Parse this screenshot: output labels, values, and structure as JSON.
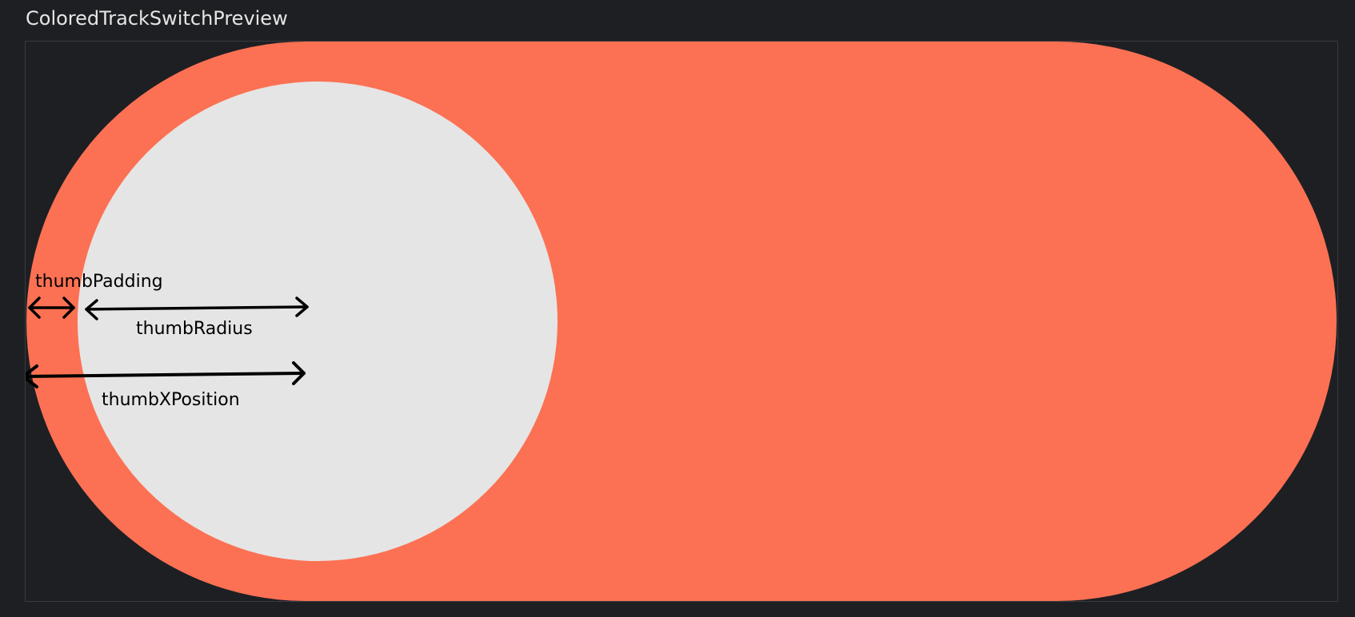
{
  "preview": {
    "title": "ColoredTrackSwitchPreview"
  },
  "switch": {
    "track_color": "#fc7153",
    "thumb_color": "#e5e5e5",
    "state": "off"
  },
  "annotations": {
    "thumb_padding": "thumbPadding",
    "thumb_radius": "thumbRadius",
    "thumb_x_position": "thumbXPosition"
  },
  "colors": {
    "background": "#1e1f23",
    "annotation_ink": "#000000"
  }
}
